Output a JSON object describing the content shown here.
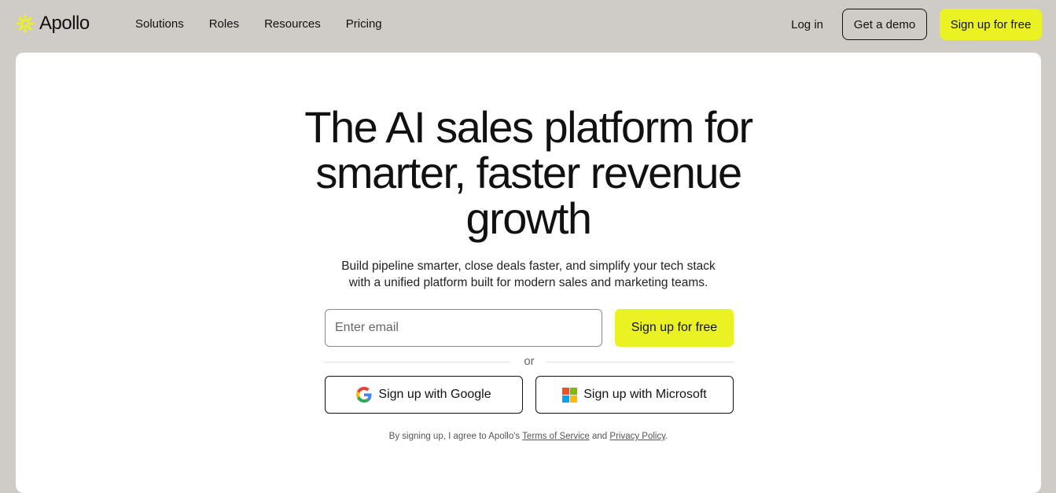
{
  "brand": {
    "name": "Apollo",
    "logo_icon": "apollo-sun-icon",
    "accent_color": "#ebf224"
  },
  "nav": {
    "items": [
      {
        "label": "Solutions"
      },
      {
        "label": "Roles"
      },
      {
        "label": "Resources"
      },
      {
        "label": "Pricing"
      }
    ],
    "login_label": "Log in",
    "demo_label": "Get a demo",
    "signup_label": "Sign up for free"
  },
  "hero": {
    "title_lines": [
      "The AI sales platform for",
      "smarter, faster revenue",
      "growth"
    ],
    "subtitle_lines": [
      "Build pipeline smarter, close deals faster, and simplify your tech stack",
      "with a unified platform built for modern sales and marketing teams."
    ],
    "email_placeholder": "Enter email",
    "email_value": "",
    "signup_label": "Sign up for free",
    "or_label": "or",
    "google_label": "Sign up with Google",
    "google_icon": "google-icon",
    "microsoft_label": "Sign up with Microsoft",
    "microsoft_icon": "microsoft-icon"
  },
  "legal": {
    "prefix": "By signing up, I agree to Apollo's",
    "terms_label": "Terms of Service",
    "and_label": "and",
    "privacy_label": "Privacy Policy",
    "suffix": "."
  }
}
